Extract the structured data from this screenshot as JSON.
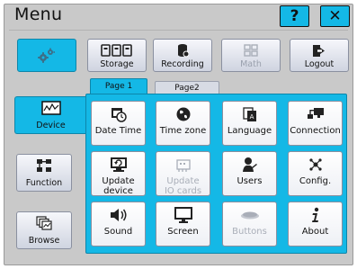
{
  "window": {
    "title": "Menu",
    "help_label": "?",
    "close_label": "✕"
  },
  "toolbar": {
    "settings_icon": "gears-icon",
    "items": [
      {
        "label": "Storage",
        "icon": "storage-icon",
        "enabled": true
      },
      {
        "label": "Recording",
        "icon": "recording-icon",
        "enabled": true
      },
      {
        "label": "Math",
        "icon": "math-icon",
        "enabled": false
      },
      {
        "label": "Logout",
        "icon": "logout-icon",
        "enabled": true
      }
    ]
  },
  "sidebar": {
    "items": [
      {
        "label": "Device",
        "icon": "device-icon",
        "active": true
      },
      {
        "label": "Function",
        "icon": "function-icon",
        "active": false
      },
      {
        "label": "Browse",
        "icon": "browse-icon",
        "active": false
      }
    ]
  },
  "tabs": [
    {
      "label": "Page 1",
      "active": true
    },
    {
      "label": "Page2",
      "active": false
    }
  ],
  "grid": [
    {
      "label": "Date Time",
      "icon": "calendar-clock-icon",
      "enabled": true
    },
    {
      "label": "Time zone",
      "icon": "globe-icon",
      "enabled": true
    },
    {
      "label": "Language",
      "icon": "language-icon",
      "enabled": true
    },
    {
      "label": "Connection",
      "icon": "network-icon",
      "enabled": true
    },
    {
      "label": "Update\ndevice",
      "icon": "update-device-icon",
      "enabled": true
    },
    {
      "label": "Update\nIO cards",
      "icon": "update-io-icon",
      "enabled": false
    },
    {
      "label": "Users",
      "icon": "users-icon",
      "enabled": true
    },
    {
      "label": "Config.",
      "icon": "config-icon",
      "enabled": true
    },
    {
      "label": "Sound",
      "icon": "speaker-icon",
      "enabled": true
    },
    {
      "label": "Screen",
      "icon": "monitor-icon",
      "enabled": true
    },
    {
      "label": "Buttons",
      "icon": "button-icon",
      "enabled": false
    },
    {
      "label": "About",
      "icon": "info-icon",
      "enabled": true
    }
  ],
  "colors": {
    "accent": "#14b8e6",
    "frame_bg": "#c9c9c9"
  }
}
